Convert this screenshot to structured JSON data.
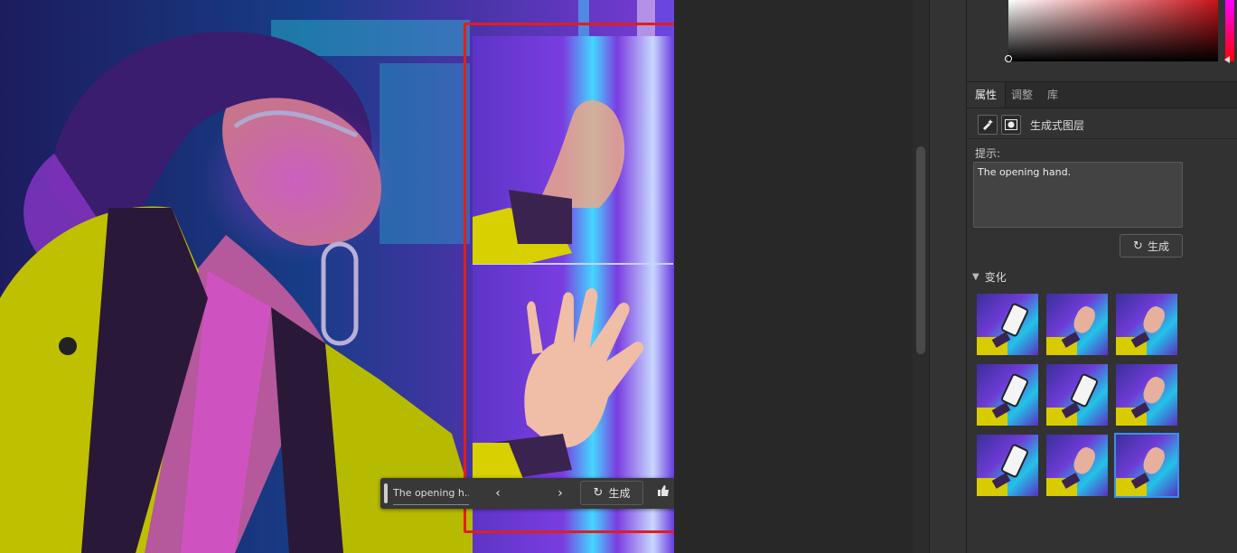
{
  "canvas": {
    "description_hidden": ""
  },
  "panel": {
    "tabs": [
      "属性",
      "调整",
      "库"
    ],
    "layer_name": "生成式图层",
    "prompt_label": "提示:",
    "prompt_value": "The opening hand.",
    "generate_label": "生成",
    "variations_label": "变化",
    "variation_kinds": [
      "phone",
      "hand",
      "hand",
      "phone",
      "phone",
      "hand",
      "phone",
      "hand",
      "hand"
    ],
    "selected_variation": 9
  },
  "toolbar": {
    "prompt_preview": "The opening h...",
    "prev_icon": "‹",
    "next_icon": "›",
    "generate_label": "生成",
    "more_icon": "···"
  },
  "colors": {
    "accent": "#3d8ee9",
    "highlight_box": "#e21e1e",
    "panel_bg": "#323232"
  }
}
